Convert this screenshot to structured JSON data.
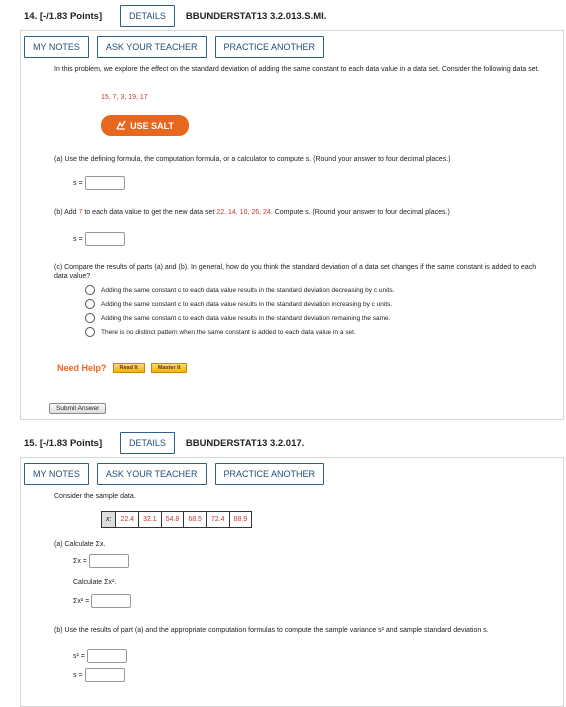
{
  "q14": {
    "number": "14. [-/1.83 Points]",
    "details_label": "DETAILS",
    "code": "BBUNDERSTAT13 3.2.013.S.MI.",
    "my_notes": "MY NOTES",
    "ask_teacher": "ASK YOUR TEACHER",
    "practice_another": "PRACTICE ANOTHER",
    "intro": "In this problem, we explore the effect on the standard deviation of adding the same constant to each data value in a data set. Consider the following data set.",
    "dataset": "15, 7, 3, 19, 17",
    "salt_label": "USE SALT",
    "part_a": "(a)  Use the defining formula, the computation formula, or a calculator to compute s. (Round your answer to four decimal places.)",
    "s_label": "s =",
    "part_b_prefix": "(b)  Add",
    "part_b_seven": "7",
    "part_b_mid": "to each data value to get the new data set",
    "part_b_data": "22, 14, 10, 26, 24.",
    "part_b_suffix": "Compute s. (Round your answer to four decimal places.)",
    "part_c": "(c)  Compare the results of parts (a) and (b). In general, how do you think the standard deviation of a data set changes if the same constant is added to each data value?",
    "options": [
      "Adding the same constant c to each data value results in the standard deviation decreasing by c units.",
      "Adding the same constant c to each data value results in the standard deviation increasing by c units.",
      "Adding the same constant c to each data value results in the standard deviation remaining the same.",
      "There is no distinct pattern when the same constant is added to each data value in a set."
    ],
    "need_help": "Need Help?",
    "read_it": "Read It",
    "master_it": "Master It",
    "submit": "Submit Answer"
  },
  "q15": {
    "number": "15. [-/1.83 Points]",
    "details_label": "DETAILS",
    "code": "BBUNDERSTAT13 3.2.017.",
    "my_notes": "MY NOTES",
    "ask_teacher": "ASK YOUR TEACHER",
    "practice_another": "PRACTICE ANOTHER",
    "intro": "Consider the sample data.",
    "x_label": "x:",
    "values": [
      "22.4",
      "32.1",
      "54.8",
      "68.5",
      "72.4",
      "88.9"
    ],
    "part_a": "(a)  Calculate Σx.",
    "sum_x_label": "Σx =",
    "calc_x2": "Calculate Σx².",
    "sum_x2_label": "Σx² =",
    "part_b": "(b)  Use the results of part (a) and the appropriate computation formulas to compute the sample variance s² and sample standard deviation s.",
    "s2_label": "s² =",
    "s_label": "s ="
  }
}
